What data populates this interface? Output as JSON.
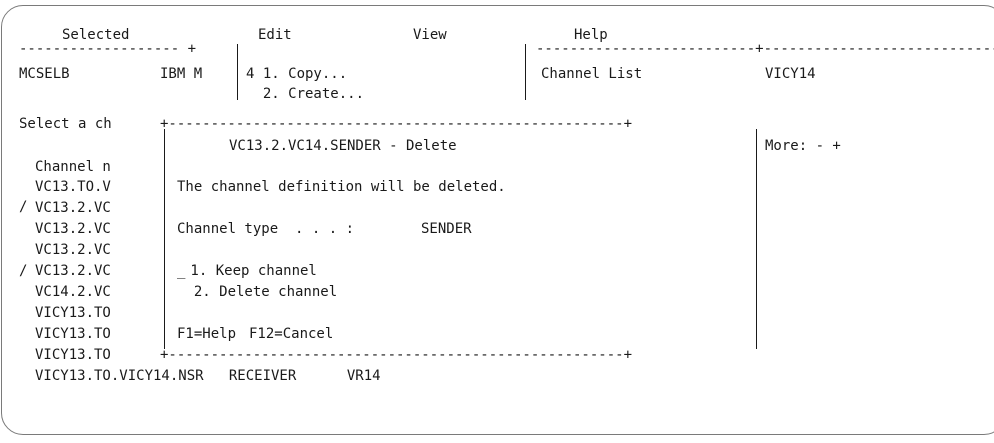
{
  "menubar": {
    "selected": "Selected",
    "edit": "Edit",
    "view": "View",
    "help": "Help",
    "dash_left": "------------------- +",
    "dash_right": "--------------------------+------------------------------"
  },
  "header": {
    "panel_id": "MCSELB",
    "product": "IBM M",
    "title": "Channel List",
    "qmgr": "VICY14"
  },
  "edit_menu": {
    "item1": "4 1. Copy...",
    "item2": "  2. Create..."
  },
  "background": {
    "instruction": "Select a ch",
    "more_indicator": "More: - +",
    "column_header": "Channel n",
    "rows": [
      {
        "sel": "",
        "name": "VC13.TO.V"
      },
      {
        "sel": "",
        "name": "VC13.2.VC"
      },
      {
        "sel": "",
        "name": "VC13.2.VC"
      },
      {
        "sel": "",
        "name": "VC13.2.VC"
      },
      {
        "sel": "/",
        "name": "VC13.2.VC"
      },
      {
        "sel": "",
        "name": "VC14.2.VC"
      },
      {
        "sel": "",
        "name": "VICY13.TO"
      },
      {
        "sel": "",
        "name": "VICY13.TO"
      },
      {
        "sel": "",
        "name": "VICY13.TO"
      }
    ],
    "last_row": "VICY13.TO.VICY14.NSR   RECEIVER      VR14"
  },
  "dialog": {
    "top_border": "+------------------------------------------------------+",
    "bottom_border": "+------------------------------------------------------+",
    "title": "VC13.2.VC14.SENDER - Delete",
    "message": "The channel definition will be deleted.",
    "channel_type_label": "Channel type  . . . :",
    "channel_type_value": "SENDER",
    "selection_field": "_",
    "option1": " 1. Keep channel",
    "option2": "  2. Delete channel",
    "f1": "F1=Help",
    "f12": "F12=Cancel"
  }
}
